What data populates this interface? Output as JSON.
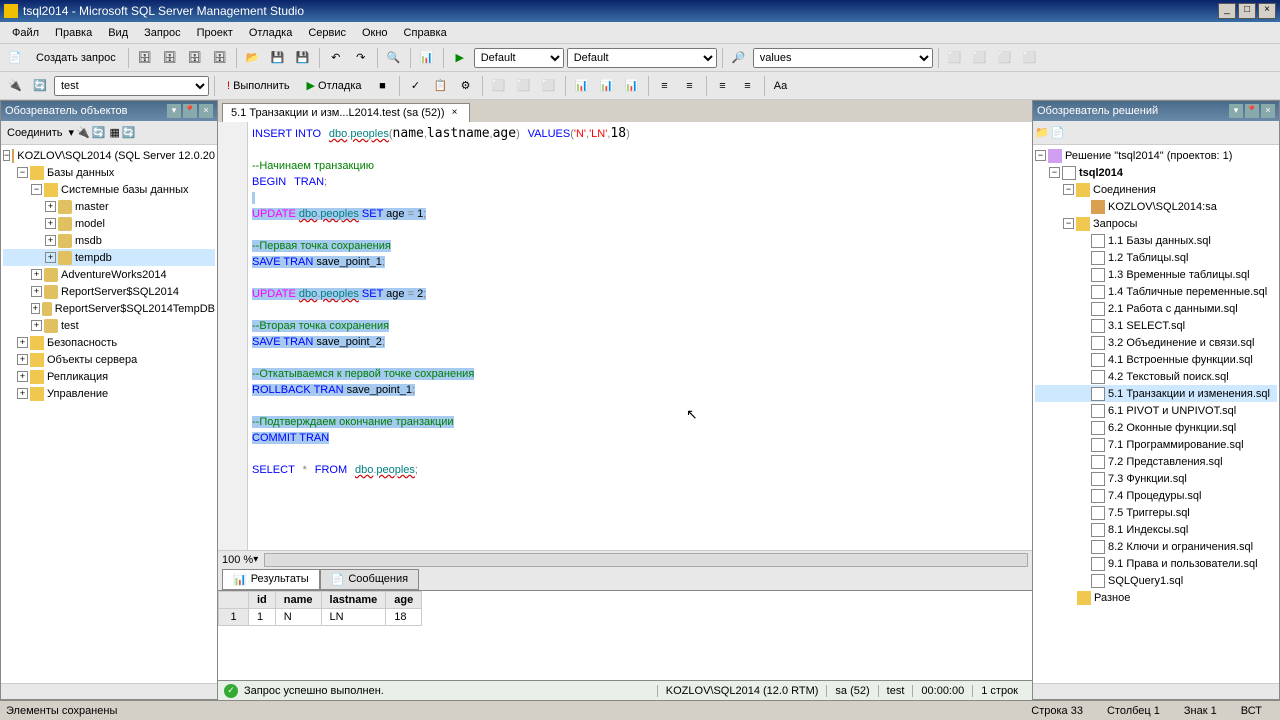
{
  "title": "tsql2014 - Microsoft SQL Server Management Studio",
  "menu": [
    "Файл",
    "Правка",
    "Вид",
    "Запрос",
    "Проект",
    "Отладка",
    "Сервис",
    "Окно",
    "Справка"
  ],
  "toolbar1": {
    "newquery": "Создать запрос",
    "combo1": "Default",
    "combo2": "Default",
    "combo3": "values"
  },
  "toolbar2": {
    "dbcombo": "test",
    "execute": "Выполнить",
    "debug": "Отладка"
  },
  "objexplorer": {
    "title": "Обозреватель объектов",
    "connect": "Соединить",
    "server": "KOZLOV\\SQL2014 (SQL Server 12.0.20",
    "databases": "Базы данных",
    "sysdbs": "Системные базы данных",
    "sysdb_list": [
      "master",
      "model",
      "msdb",
      "tempdb"
    ],
    "userdbs": [
      "AdventureWorks2014",
      "ReportServer$SQL2014",
      "ReportServer$SQL2014TempDB",
      "test"
    ],
    "folders": [
      "Безопасность",
      "Объекты сервера",
      "Репликация",
      "Управление"
    ]
  },
  "tab_title": "5.1 Транзакции и изм...L2014.test (sa (52))",
  "zoom": "100 %",
  "results": {
    "tab1": "Результаты",
    "tab2": "Сообщения",
    "headers": [
      "id",
      "name",
      "lastname",
      "age"
    ],
    "row": [
      "1",
      "N",
      "LN",
      "18"
    ]
  },
  "querystatus": {
    "msg": "Запрос успешно выполнен.",
    "server": "KOZLOV\\SQL2014 (12.0 RTM)",
    "user": "sa (52)",
    "db": "test",
    "time": "00:00:00",
    "rows": "1 строк"
  },
  "solution": {
    "title": "Обозреватель решений",
    "root": "Решение \"tsql2014\" (проектов: 1)",
    "project": "tsql2014",
    "connections": "Соединения",
    "conn_item": "KOZLOV\\SQL2014:sa",
    "queries": "Запросы",
    "files": [
      "1.1 Базы данных.sql",
      "1.2 Таблицы.sql",
      "1.3 Временные таблицы.sql",
      "1.4 Табличные переменные.sql",
      "2.1 Работа с данными.sql",
      "3.1 SELECT.sql",
      "3.2 Объединение и связи.sql",
      "4.1 Встроенные функции.sql",
      "4.2 Текстовый поиск.sql",
      "5.1 Транзакции и изменения.sql",
      "6.1 PIVOT и UNPIVOT.sql",
      "6.2 Оконные функции.sql",
      "7.1 Программирование.sql",
      "7.2 Представления.sql",
      "7.3 Функции.sql",
      "7.4 Процедуры.sql",
      "7.5 Триггеры.sql",
      "8.1 Индексы.sql",
      "8.2 Ключи и ограничения.sql",
      "9.1 Права и пользователи.sql",
      "SQLQuery1.sql"
    ],
    "selected": "5.1 Транзакции и изменения.sql",
    "misc": "Разное"
  },
  "statusbar": {
    "msg": "Элементы сохранены",
    "line": "Строка 33",
    "col": "Столбец 1",
    "char": "Знак 1",
    "ins": "ВСТ"
  }
}
